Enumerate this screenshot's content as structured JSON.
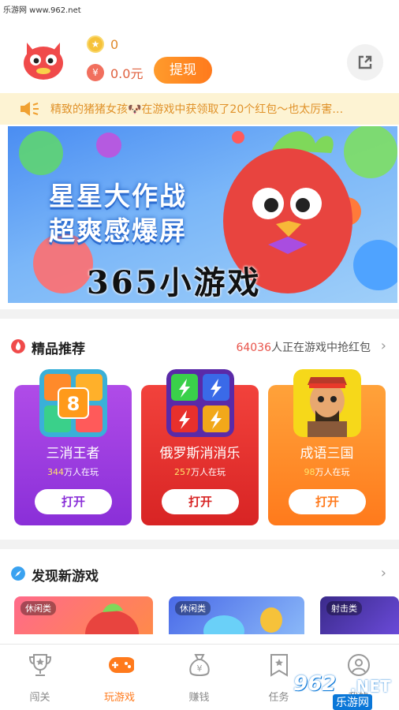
{
  "status_bar": {
    "watermark": "乐游网 www.962.net"
  },
  "header": {
    "coins": "0",
    "cash": "0.0元",
    "withdraw_label": "提现"
  },
  "notice": {
    "text": "精致的猪猪女孩🐶在游戏中获领取了20个红包～也太厉害…"
  },
  "banner": {
    "title_line1": "星星大作战",
    "title_line2": "超爽感爆屏",
    "brand": "365小游戏"
  },
  "featured": {
    "title": "精品推荐",
    "live_count": "64036",
    "live_suffix": "人正在游戏中抢红包",
    "games": [
      {
        "name": "三消王者",
        "players": "344",
        "players_suffix": "万人在玩",
        "open_label": "打开",
        "color": "#9a3ee0"
      },
      {
        "name": "俄罗斯消消乐",
        "players": "257",
        "players_suffix": "万人在玩",
        "open_label": "打开",
        "color": "#e8302c"
      },
      {
        "name": "成语三国",
        "players": "98",
        "players_suffix": "万人在玩",
        "open_label": "打开",
        "color": "#ff8a1c"
      }
    ]
  },
  "discover": {
    "title": "发现新游戏",
    "cards": [
      {
        "tag": "休闲类"
      },
      {
        "tag": "休闲类"
      },
      {
        "tag": "射击类"
      }
    ]
  },
  "tabbar": {
    "tabs": [
      {
        "label": "闯关",
        "icon": "trophy-icon"
      },
      {
        "label": "玩游戏",
        "icon": "gamepad-icon",
        "active": true
      },
      {
        "label": "赚钱",
        "icon": "money-bag-icon"
      },
      {
        "label": "任务",
        "icon": "task-icon"
      },
      {
        "label": "我的",
        "icon": "profile-icon"
      }
    ]
  },
  "watermark_962": {
    "number": "962",
    "suffix": ".NET",
    "sub": "乐游网"
  },
  "colors": {
    "accent": "#ff7a1c",
    "notice_bg": "#fdf3d3",
    "notice_text": "#e0922a",
    "red": "#e8534a"
  }
}
